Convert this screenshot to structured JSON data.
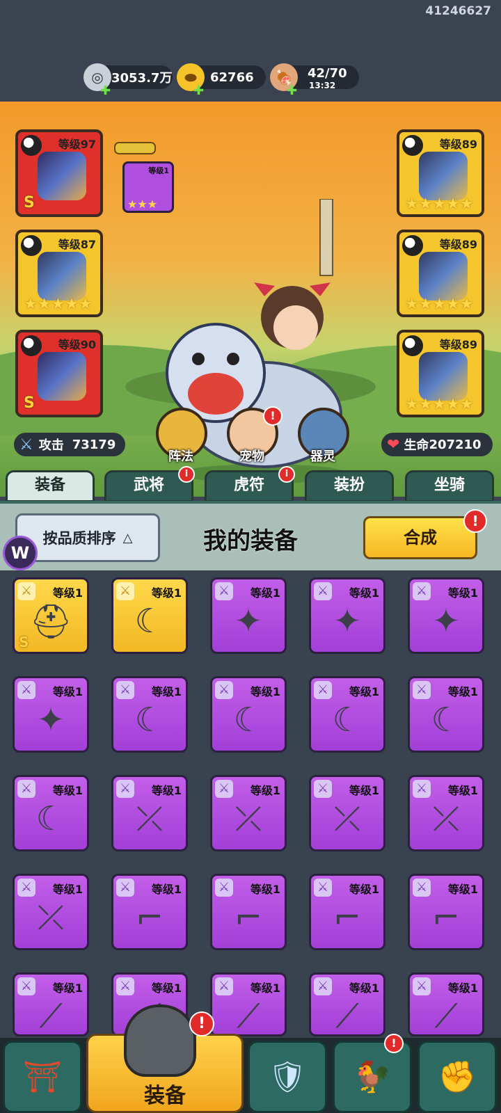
{
  "uid": "41246627",
  "resources": {
    "silver": "3053.7万",
    "gold": "62766",
    "stamina": "42/70",
    "stamina_timer": "13:32"
  },
  "equipped": {
    "left": [
      {
        "level": "等级97",
        "rarity": "S",
        "color": "red"
      },
      {
        "level": "等级87",
        "stars": "★★★★★",
        "color": "gold"
      },
      {
        "level": "等级90",
        "rarity": "S",
        "color": "red"
      }
    ],
    "right": [
      {
        "level": "等级89",
        "stars": "★★★★★",
        "color": "gold"
      },
      {
        "level": "等级89",
        "stars": "★★★★★",
        "color": "gold"
      },
      {
        "level": "等级89",
        "stars": "★★★★★",
        "color": "gold"
      }
    ],
    "small": {
      "level": "等级1",
      "stars": "★★★"
    }
  },
  "stats": {
    "attack_label": "攻击",
    "attack": "73179",
    "hp_label": "生命",
    "hp": "207210"
  },
  "circle_buttons": [
    "阵法",
    "宠物",
    "器灵"
  ],
  "tabs": [
    "装备",
    "武将",
    "虎符",
    "装扮",
    "坐骑"
  ],
  "panel": {
    "sort_label": "按品质排序",
    "title": "我的装备",
    "combine_label": "合成"
  },
  "inventory": {
    "level_label": "等级1",
    "rows": [
      [
        "helmet-gold-S",
        "sickle-gold",
        "shuriken",
        "shuriken",
        "shuriken"
      ],
      [
        "shuriken",
        "sickle",
        "sickle",
        "sickle",
        "sickle"
      ],
      [
        "sickle",
        "crossbow",
        "crossbow",
        "crossbow",
        "crossbow"
      ],
      [
        "crossbow",
        "pistol",
        "pistol",
        "pistol",
        "pistol"
      ],
      [
        "blade",
        "blade",
        "blade",
        "blade",
        "blade"
      ]
    ]
  },
  "bottom_nav": {
    "equip_label": "装备"
  },
  "colors": {
    "accent_gold": "#f4c62b",
    "accent_red": "#e0302c",
    "item_purple": "#b04ee0",
    "tab_green": "#2f5a52"
  }
}
